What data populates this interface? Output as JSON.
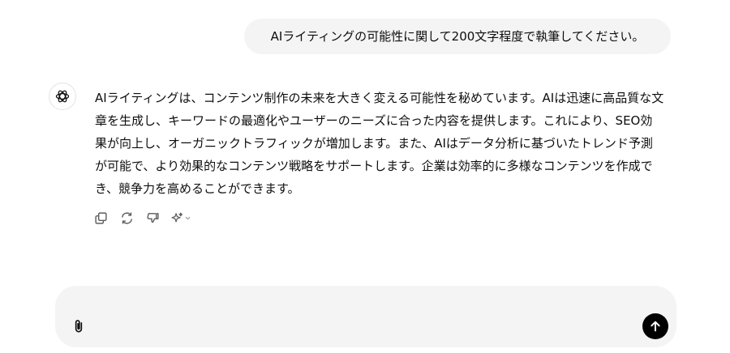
{
  "conversation": {
    "user_message": "AIライティングの可能性に関して200文字程度で執筆してください。",
    "assistant_message": "AIライティングは、コンテンツ制作の未来を大きく変える可能性を秘めています。AIは迅速に高品質な文章を生成し、キーワードの最適化やユーザーのニーズに合った内容を提供します。これにより、SEO効果が向上し、オーガニックトラフィックが増加します。また、AIはデータ分析に基づいたトレンド予測が可能で、より効果的なコンテンツ戦略をサポートします。企業は効率的に多様なコンテンツを作成でき、競争力を高めることができます。",
    "assistant_avatar_icon": "openai-logo-icon"
  },
  "message_actions": [
    {
      "icon": "copy-icon"
    },
    {
      "icon": "regenerate-icon"
    },
    {
      "icon": "thumbs-down-icon"
    },
    {
      "icon": "sparkle-model-icon"
    }
  ],
  "composer": {
    "value": "",
    "attach_icon": "paperclip-icon",
    "send_icon": "arrow-up-icon"
  },
  "colors": {
    "bubble_bg": "#f4f4f4",
    "composer_bg": "#f4f4f4",
    "send_button_bg": "#000000",
    "icon_gray": "#5d5d5d"
  }
}
